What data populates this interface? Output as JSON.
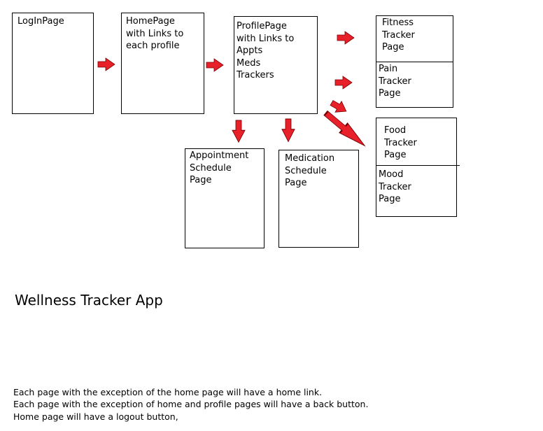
{
  "diagram": {
    "boxes": {
      "login": "LogInPage",
      "home": "HomePage\nwith Links to\neach profile",
      "profile": "ProfilePage\nwith Links to\nAppts\nMeds\nTrackers",
      "appointment": "Appointment\nSchedule\nPage",
      "medication": "Medication\nSchedule\nPage",
      "fitness": "Fitness\nTracker\nPage",
      "pain": "Pain\nTracker\nPage",
      "food": "Food\nTracker\nPage",
      "mood": "Mood\nTracker\nPage"
    },
    "arrow_color": "#e8202a"
  },
  "title": "Wellness Tracker App",
  "notes": [
    "Each page with the exception of the home page will have a home link.",
    "Each page with the exception of home and profile pages will have a back button.",
    "Home page will have a logout button,"
  ]
}
